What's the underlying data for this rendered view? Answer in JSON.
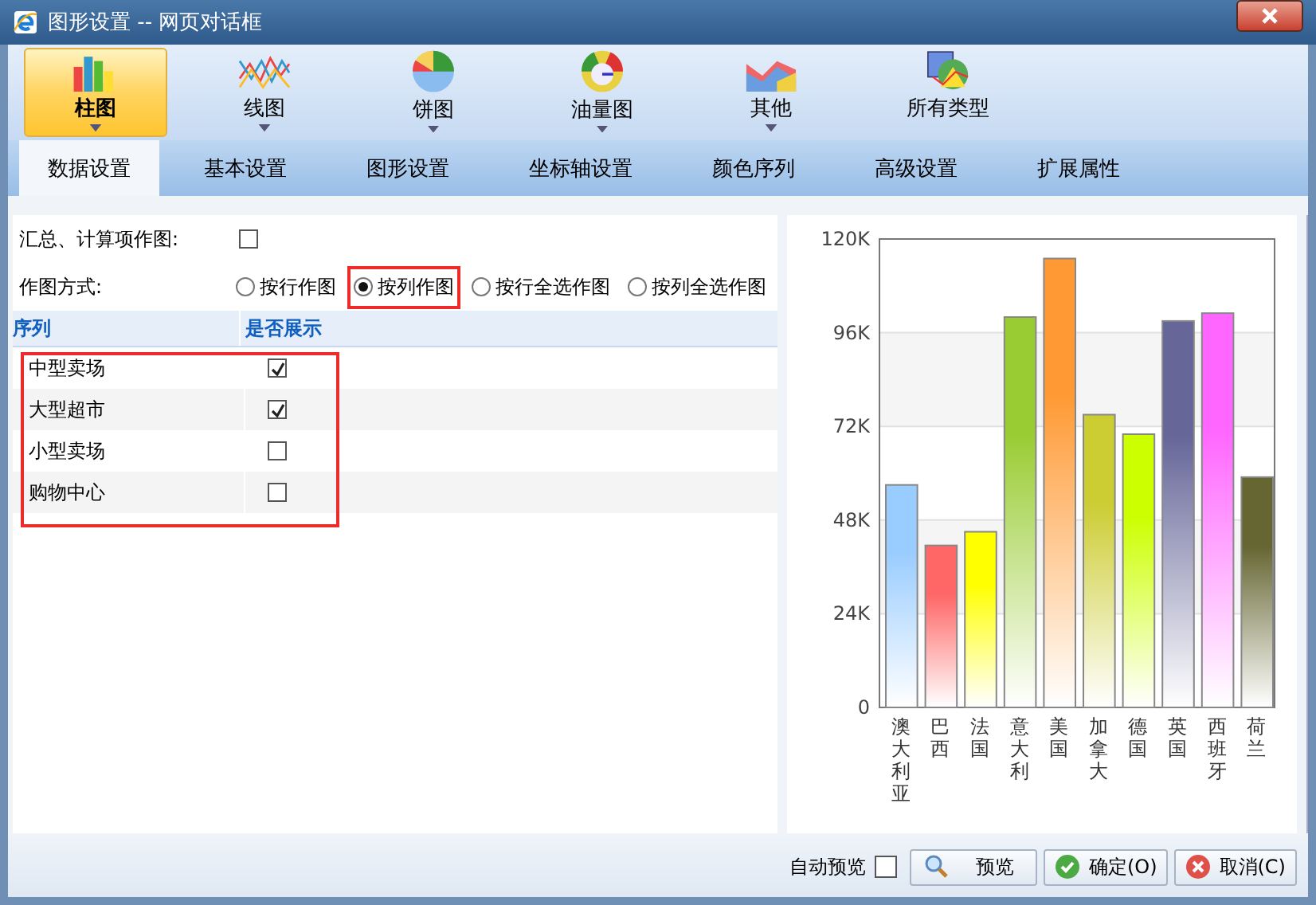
{
  "window": {
    "title": "图形设置 -- 网页对话框"
  },
  "chart_types": [
    {
      "label": "柱图",
      "kind": "bar",
      "selected": true,
      "has_menu": true
    },
    {
      "label": "线图",
      "kind": "line",
      "selected": false,
      "has_menu": true
    },
    {
      "label": "饼图",
      "kind": "pie",
      "selected": false,
      "has_menu": true
    },
    {
      "label": "油量图",
      "kind": "gauge",
      "selected": false,
      "has_menu": true
    },
    {
      "label": "其他",
      "kind": "area",
      "selected": false,
      "has_menu": true
    },
    {
      "label": "所有类型",
      "kind": "all",
      "selected": false,
      "has_menu": false
    }
  ],
  "tabs": [
    {
      "label": "数据设置",
      "selected": true
    },
    {
      "label": "基本设置",
      "selected": false
    },
    {
      "label": "图形设置",
      "selected": false
    },
    {
      "label": "坐标轴设置",
      "selected": false
    },
    {
      "label": "颜色序列",
      "selected": false
    },
    {
      "label": "高级设置",
      "selected": false
    },
    {
      "label": "扩展属性",
      "selected": false
    }
  ],
  "settings": {
    "summary_label": "汇总、计算项作图:",
    "summary_checked": false,
    "mode_label": "作图方式:",
    "modes": [
      {
        "label": "按行作图",
        "selected": false,
        "highlighted": false
      },
      {
        "label": "按列作图",
        "selected": true,
        "highlighted": true
      },
      {
        "label": "按行全选作图",
        "selected": false,
        "highlighted": false
      },
      {
        "label": "按列全选作图",
        "selected": false,
        "highlighted": false
      }
    ]
  },
  "series_table": {
    "columns": [
      "序列",
      "是否展示"
    ],
    "highlighted": true,
    "rows": [
      {
        "name": "中型卖场",
        "checked": true
      },
      {
        "name": "大型超市",
        "checked": true
      },
      {
        "name": "小型卖场",
        "checked": false
      },
      {
        "name": "购物中心",
        "checked": false
      }
    ]
  },
  "preview": {
    "chart_data": {
      "type": "bar",
      "categories": [
        "澳大利亚",
        "巴西",
        "法国",
        "意大利",
        "美国",
        "加拿大",
        "德国",
        "英国",
        "西班牙",
        "荷兰"
      ],
      "grid": true,
      "series": [
        {
          "values": [
            57000,
            41500,
            45000,
            100000,
            115000,
            75000,
            70000,
            99000,
            101000,
            59000
          ]
        }
      ],
      "colors": [
        "#99ccff",
        "#ff6666",
        "#ffff00",
        "#99cc33",
        "#ff9933",
        "#cccc33",
        "#ccff00",
        "#666699",
        "#ff66ff",
        "#666633"
      ],
      "ylim": [
        0,
        120000
      ],
      "yticks": [
        {
          "value": 0,
          "label": "0"
        },
        {
          "value": 24000,
          "label": "24K"
        },
        {
          "value": 48000,
          "label": "48K"
        },
        {
          "value": 72000,
          "label": "72K"
        },
        {
          "value": 96000,
          "label": "96K"
        },
        {
          "value": 120000,
          "label": "120K"
        }
      ]
    }
  },
  "footer": {
    "auto_preview_label": "自动预览",
    "auto_preview_checked": false,
    "buttons": [
      {
        "label": "预览",
        "kind": "preview"
      },
      {
        "label": "确定(O)",
        "kind": "ok"
      },
      {
        "label": "取消(C)",
        "kind": "cancel"
      }
    ]
  }
}
